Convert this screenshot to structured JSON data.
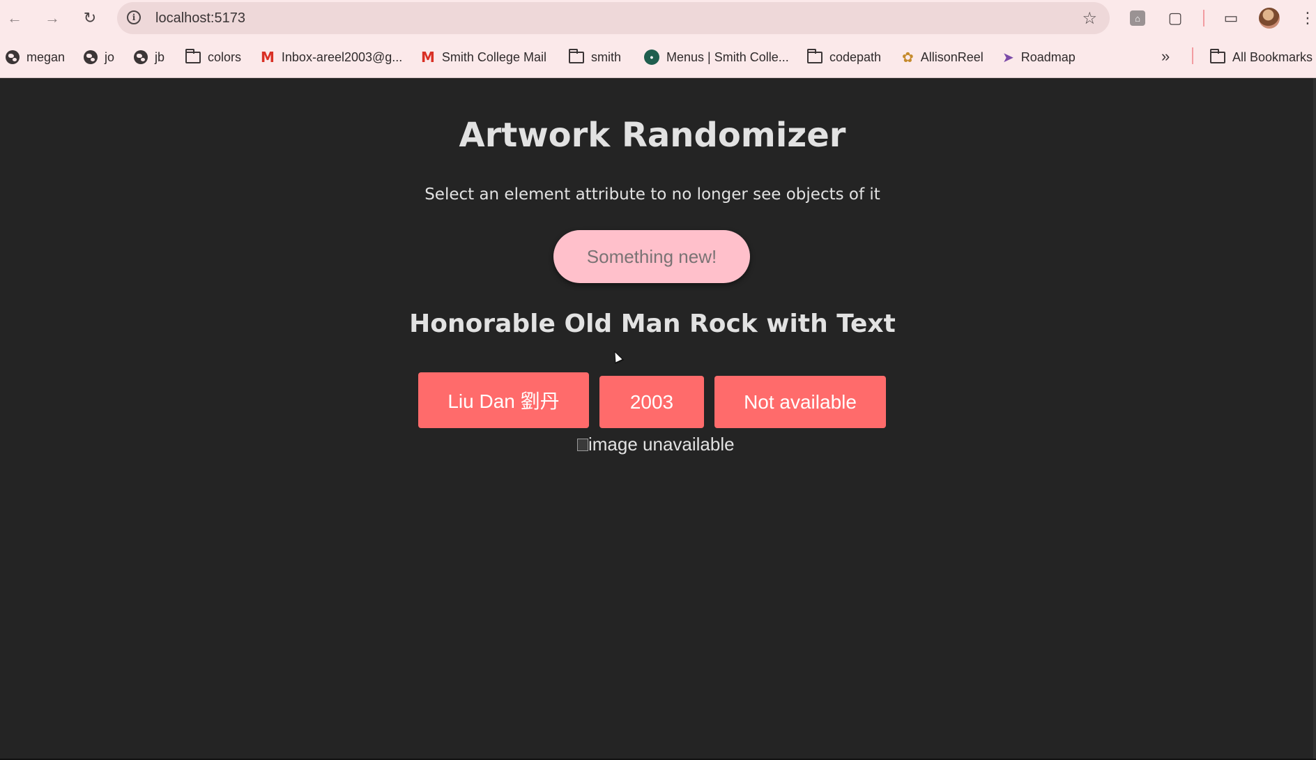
{
  "browser": {
    "url": "localhost:5173",
    "bookmarks": [
      {
        "label": "megan",
        "icon": "globe-icon"
      },
      {
        "label": "jo",
        "icon": "globe-icon"
      },
      {
        "label": "jb",
        "icon": "globe-icon"
      },
      {
        "label": "colors",
        "icon": "folder-icon"
      },
      {
        "label": "Inbox-areel2003@g...",
        "icon": "gmail-icon"
      },
      {
        "label": "Smith College Mail",
        "icon": "gmail-icon"
      },
      {
        "label": "smith",
        "icon": "folder-icon"
      },
      {
        "label": "Menus | Smith Colle...",
        "icon": "dining-logo-icon"
      },
      {
        "label": "codepath",
        "icon": "folder-icon"
      },
      {
        "label": "AllisonReel",
        "icon": "bird-icon"
      },
      {
        "label": "Roadmap",
        "icon": "rocket-icon"
      }
    ],
    "all_bookmarks": "All Bookmarks",
    "more": "»"
  },
  "app": {
    "title": "Artwork Randomizer",
    "subtitle": "Select an element attribute to no longer see objects of it",
    "new_button": "Something new!",
    "artwork_title": "Honorable Old Man Rock with Text",
    "attributes": [
      "Liu Dan 劉丹",
      "2003",
      "Not available"
    ],
    "image_alt": "image unavailable"
  },
  "colors": {
    "background": "#242424",
    "new_button_bg": "#ffc0cb",
    "attribute_button_bg": "#ff6b6b",
    "chrome_bg": "#fbe9ea"
  }
}
